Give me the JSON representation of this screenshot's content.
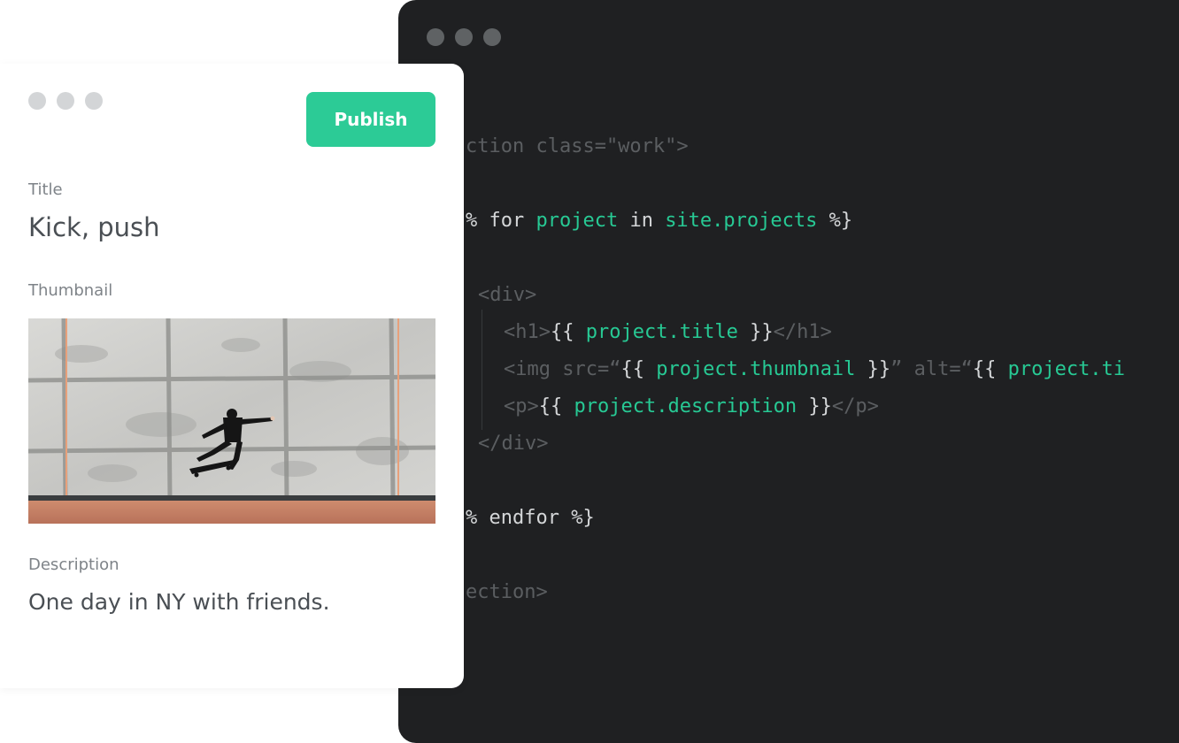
{
  "code_editor": {
    "lines": [
      [
        {
          "t": "ction class=\"work\">",
          "c": "dim"
        }
      ],
      [
        {
          "t": "% for ",
          "c": "text"
        },
        {
          "t": "project",
          "c": "green"
        },
        {
          "t": " in ",
          "c": "text"
        },
        {
          "t": "site.projects",
          "c": "green"
        },
        {
          "t": " %}",
          "c": "text"
        }
      ],
      [
        {
          "t": "<div>",
          "c": "dim"
        }
      ],
      [
        {
          "t": "<h1>",
          "c": "dim"
        },
        {
          "t": "{{ ",
          "c": "text"
        },
        {
          "t": "project.title",
          "c": "green"
        },
        {
          "t": " }}",
          "c": "text"
        },
        {
          "t": "</h1>",
          "c": "dim"
        }
      ],
      [
        {
          "t": "<img src=“",
          "c": "dim"
        },
        {
          "t": "{{ ",
          "c": "text"
        },
        {
          "t": "project.thumbnail",
          "c": "green"
        },
        {
          "t": " }}",
          "c": "text"
        },
        {
          "t": "” alt=“",
          "c": "dim"
        },
        {
          "t": "{{ ",
          "c": "text"
        },
        {
          "t": "project.ti",
          "c": "green"
        }
      ],
      [
        {
          "t": "<p>",
          "c": "dim"
        },
        {
          "t": "{{ ",
          "c": "text"
        },
        {
          "t": "project.description",
          "c": "green"
        },
        {
          "t": " }}",
          "c": "text"
        },
        {
          "t": "</p>",
          "c": "dim"
        }
      ],
      [
        {
          "t": "</div>",
          "c": "dim"
        }
      ],
      [
        {
          "t": "% endfor %}",
          "c": "text"
        }
      ],
      [
        {
          "t": "ection>",
          "c": "dim"
        }
      ]
    ]
  },
  "cms": {
    "publish_label": "Publish",
    "title_label": "Title",
    "title_value": "Kick, push",
    "thumbnail_label": "Thumbnail",
    "thumbnail_alt": "Skateboarder doing a kickflip in front of a concrete wall",
    "description_label": "Description",
    "description_value": "One day in NY with friends."
  },
  "colors": {
    "accent": "#2ccb96",
    "code_bg": "#1f2022",
    "code_green": "#27c994"
  }
}
